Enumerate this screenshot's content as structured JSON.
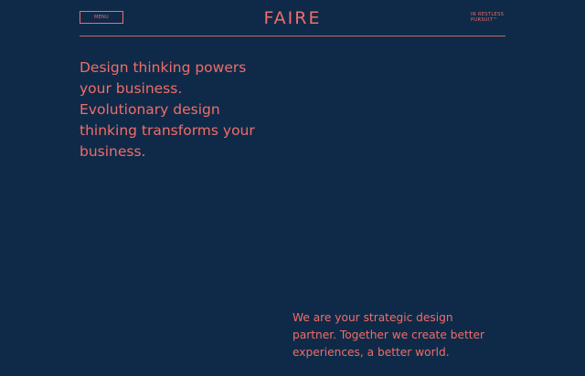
{
  "header": {
    "menu_label": "MENU",
    "logo": "FAIRE",
    "tagline_lines": [
      "IN RESTLESS",
      "PURSUIT™"
    ]
  },
  "hero": {
    "lines": [
      "Design thinking powers",
      "your business.",
      "Evolutionary design",
      "thinking transforms your",
      "business."
    ]
  },
  "mission": {
    "lines": [
      "We are your strategic design",
      "partner. Together we create better",
      "experiences, a better world."
    ]
  },
  "colors": {
    "background": "#0f2a48",
    "accent": "#f06d69",
    "divider": "#b96c6a"
  }
}
